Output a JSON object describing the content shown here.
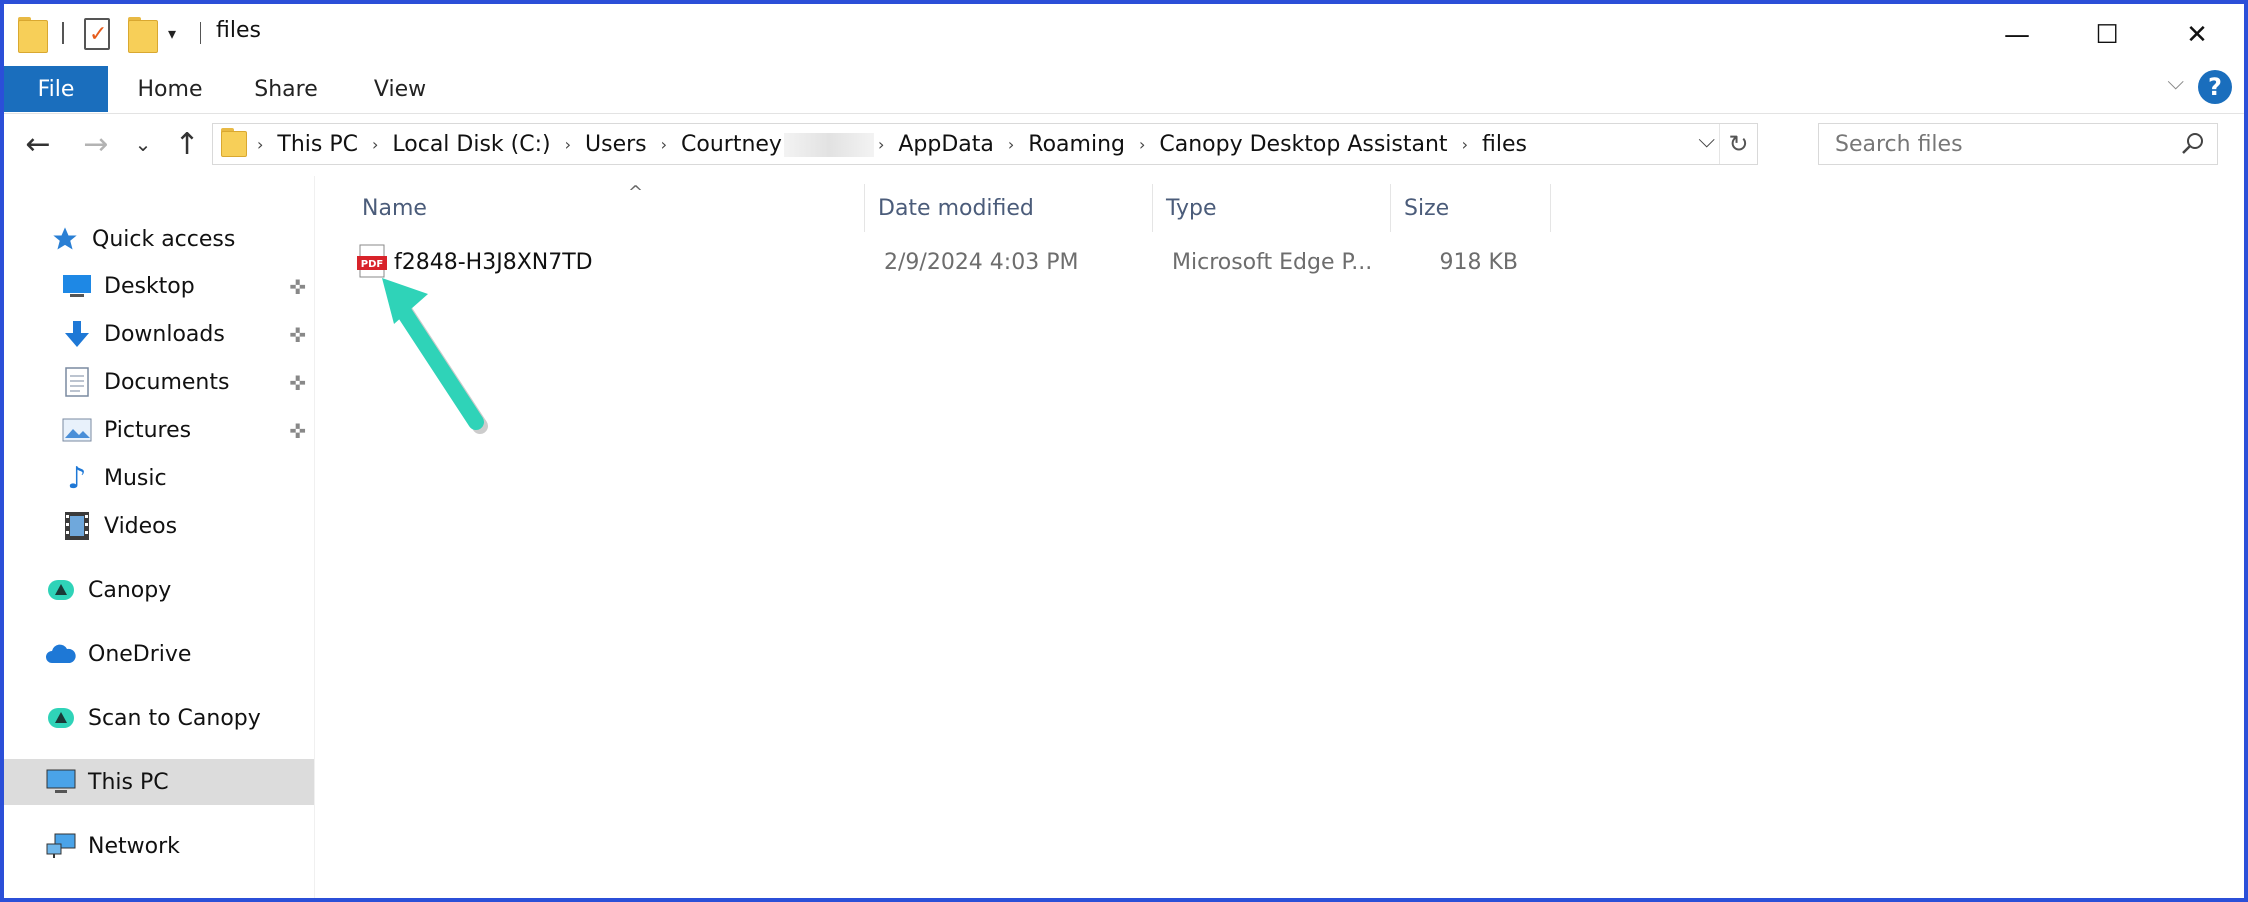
{
  "window": {
    "title": "files",
    "border_color": "#2b4fd8"
  },
  "title_bar": {
    "minimize_glyph": "—",
    "maximize_glyph": "☐",
    "close_glyph": "✕",
    "qat_dropdown_glyph": "▾"
  },
  "ribbon": {
    "tabs": [
      {
        "label": "File"
      },
      {
        "label": "Home"
      },
      {
        "label": "Share"
      },
      {
        "label": "View"
      }
    ],
    "collapse_glyph": "⌵",
    "help_glyph": "?"
  },
  "navigation": {
    "back_glyph": "←",
    "forward_glyph": "→",
    "recent_glyph": "⌄",
    "up_glyph": "↑"
  },
  "address_bar": {
    "breadcrumbs": [
      {
        "label": "This PC"
      },
      {
        "label": "Local Disk (C:)"
      },
      {
        "label": "Users"
      },
      {
        "label": "Courtney"
      },
      {
        "label": "AppData"
      },
      {
        "label": "Roaming"
      },
      {
        "label": "Canopy Desktop Assistant"
      },
      {
        "label": "files"
      }
    ],
    "separator": "›",
    "dropdown_glyph": "⌵",
    "refresh_glyph": "↻"
  },
  "search": {
    "placeholder": "Search files"
  },
  "sidebar": {
    "items": [
      {
        "label": "Quick access",
        "icon": "star-icon"
      },
      {
        "label": "Desktop",
        "icon": "desktop-icon",
        "pinned": true
      },
      {
        "label": "Downloads",
        "icon": "download-arrow-icon",
        "pinned": true
      },
      {
        "label": "Documents",
        "icon": "document-icon",
        "pinned": true
      },
      {
        "label": "Pictures",
        "icon": "pictures-icon",
        "pinned": true
      },
      {
        "label": "Music",
        "icon": "music-note-icon"
      },
      {
        "label": "Videos",
        "icon": "film-strip-icon"
      },
      {
        "label": "Canopy",
        "icon": "canopy-icon"
      },
      {
        "label": "OneDrive",
        "icon": "cloud-icon"
      },
      {
        "label": "Scan to Canopy",
        "icon": "canopy-icon"
      },
      {
        "label": "This PC",
        "icon": "computer-icon",
        "selected": true
      },
      {
        "label": "Network",
        "icon": "network-icon"
      }
    ],
    "pin_glyph": "📌"
  },
  "file_list": {
    "sort_glyph": "^",
    "columns": [
      {
        "label": "Name"
      },
      {
        "label": "Date modified"
      },
      {
        "label": "Type"
      },
      {
        "label": "Size"
      }
    ],
    "rows": [
      {
        "name": "f2848-H3J8XN7TD",
        "date_modified": "2/9/2024 4:03 PM",
        "type": "Microsoft Edge P...",
        "size": "918 KB",
        "icon": "pdf-icon",
        "icon_label": "PDF"
      }
    ]
  },
  "annotation": {
    "arrow_color": "#2fd3b8"
  },
  "colors": {
    "file_tab": "#1a6ebd",
    "selected_nav": "#dcdcdc",
    "header_text": "#4b5c7a"
  }
}
